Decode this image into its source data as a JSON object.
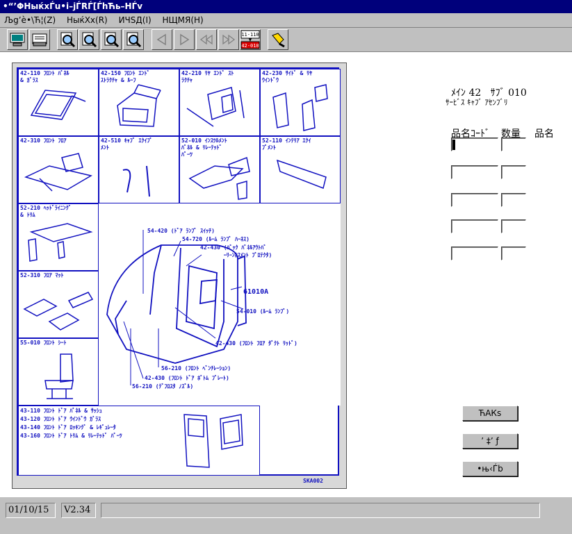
{
  "window": {
    "title": "•“’ΦHыќxЃu•i–jЃRЃ[ЃhЋь–HЃv"
  },
  "menu": {
    "items": [
      {
        "label": "Љg’è•\\Ћ¦(Z)"
      },
      {
        "label": "HыќXx(R)"
      },
      {
        "label": "ИЧЅД(I)"
      },
      {
        "label": "НЩМЯ(H)"
      }
    ]
  },
  "toolbar": {
    "buttons": [
      {
        "icon": "computer-icon"
      },
      {
        "icon": "printer-icon"
      },
      {
        "icon": "zoom-icon-1"
      },
      {
        "icon": "zoom-icon-2"
      },
      {
        "icon": "zoom-icon-3"
      },
      {
        "icon": "zoom-icon-4"
      },
      {
        "icon": "arrow-left-icon"
      },
      {
        "icon": "arrow-right-icon"
      },
      {
        "icon": "rewind-icon"
      },
      {
        "icon": "fast-forward-icon"
      },
      {
        "icon": "part-number-icon"
      },
      {
        "icon": "flashlight-icon"
      }
    ],
    "partnum_top": "11-110",
    "partnum_bottom": "42-010"
  },
  "diagram": {
    "cells": [
      {
        "caption": "42-110 ﾌﾛﾝﾄ ﾊﾟﾈﾙ\n& ｶﾞﾗｽ"
      },
      {
        "caption": "42-150 ﾌﾛﾝﾄ ｴﾝﾄﾞ\nｽﾄﾗｸﾁｬ & ﾙｰﾌ"
      },
      {
        "caption": "42-210 ﾘﾔ ｴﾝﾄﾞ ｽﾄ\nﾗｸﾁｬ"
      },
      {
        "caption": "42-230 ｻｲﾄﾞ & ﾘﾔ\nｳｲﾝﾄﾞｳ"
      },
      {
        "caption": "42-310 ﾌﾛﾝﾄ ﾌﾛｱ"
      },
      {
        "caption": "42-510 ｷｬﾌﾞ ｴｸｲﾌﾟ\nﾒﾝﾄ"
      },
      {
        "caption": "52-010 ｲﾝｽﾂﾙﾒﾝﾄ\nﾊﾟﾈﾙ & ﾘﾚｰﾃｯﾄﾞ\nﾊﾟｰﾂ"
      },
      {
        "caption": "52-110 ｲﾝﾃﾘｱ ｴｸｲ\nﾌﾟﾒﾝﾄ"
      },
      {
        "caption": "52-210 ﾍｯﾄﾞﾗｲﾆﾝｸﾞ\n& ﾄﾘﾑ"
      },
      {
        "caption": "52-310 ﾌﾛｱ ﾏｯﾄ"
      },
      {
        "caption": "55-010 ﾌﾛﾝﾄ ｼｰﾄ"
      },
      {
        "caption": "43-110 ﾌﾛﾝﾄ ﾄﾞｱ ﾊﾟﾈﾙ & ｻｯｼｭ\n43-120 ﾌﾛﾝﾄ ﾄﾞｱ ｳｲﾝﾄﾞｳ ｶﾞﾗｽ\n43-140 ﾌﾛﾝﾄ ﾄﾞｱ ﾛｯｷﾝｸﾞ & ﾚｷﾞｭﾚｰﾀ\n43-160 ﾌﾛﾝﾄ ﾄﾞｱ ﾄﾘﾑ & ﾘﾚｰﾃｯﾄﾞ ﾊﾟｰﾂ"
      }
    ],
    "callouts": [
      "54-420 (ﾄﾞｱ ﾗﾝﾌﾟ ｽｲｯﾁ)",
      "54-720 (ﾙｰﾑ ﾗﾝﾌﾟ ﾊｰﾈｽ)",
      "42-430 (ﾊﾞｯｸ ﾊﾟﾈﾙｱｳﾄﾊﾞ\n       ｰﾘｰﾝﾎｽﾒﾝﾄ ﾌﾟﾛﾃｸﾀ)",
      "61010A",
      "54-010 (ﾙｰﾑ ﾗﾝﾌﾟ)",
      "42-430 (ﾌﾛﾝﾄ ﾌﾛｱ ﾀﾞｸﾄ ﾘｯﾄﾞ)",
      "56-210 (ﾌﾛﾝﾄ ﾍﾞﾝﾁﾚｰｼｮﾝ)",
      "42-430 (ﾌﾛﾝﾄ ﾄﾞｱ ﾎﾞﾄﾑ ﾌﾟﾚｰﾄ)",
      "56-210 (ﾃﾞﾌﾛｽﾀ ﾉｽﾞﾙ)"
    ],
    "code": "SKA002"
  },
  "info": {
    "main_label": "ﾒｲﾝ 42",
    "sub_label": "ｻﾌﾞ 010",
    "assembly": "ｻｰﾋﾞｽ ｷｬﾌﾞ ｱｾﾝﾌﾞﾘ"
  },
  "columns": {
    "code": "品名ｺｰﾄﾞ",
    "qty": "数量",
    "name": "品名"
  },
  "rows": [
    {
      "code": "",
      "qty": ""
    },
    {
      "code": "",
      "qty": ""
    },
    {
      "code": "",
      "qty": ""
    },
    {
      "code": "",
      "qty": ""
    },
    {
      "code": "",
      "qty": ""
    }
  ],
  "buttons": {
    "b1": "ЋАКѕ",
    "b2": "’ ‡’ ƒ",
    "b3": "•њ‹Ѓb"
  },
  "status": {
    "date": "01/10/15",
    "version": "V2.34",
    "message": ""
  }
}
